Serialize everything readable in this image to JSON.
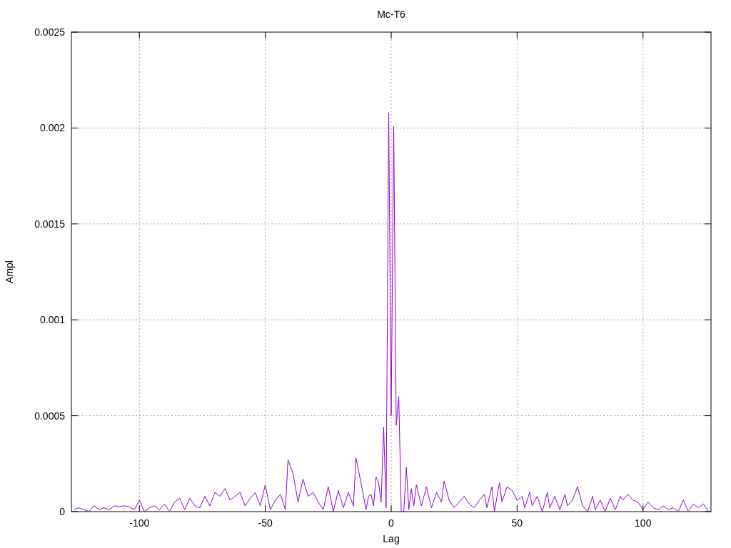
{
  "chart_data": {
    "type": "line",
    "title": "Mc-T6",
    "xlabel": "Lag",
    "ylabel": "Ampl",
    "grid": true,
    "xlim": [
      -127,
      127
    ],
    "ylim": [
      0,
      0.0025
    ],
    "xticks": [
      -100,
      -50,
      0,
      50,
      100
    ],
    "yticks": [
      {
        "value": 0,
        "label": "0"
      },
      {
        "value": 0.0005,
        "label": "0.0005"
      },
      {
        "value": 0.001,
        "label": "0.001"
      },
      {
        "value": 0.0015,
        "label": "0.0015"
      },
      {
        "value": 0.002,
        "label": "0.002"
      },
      {
        "value": 0.0025,
        "label": "0.0025"
      }
    ],
    "x": [
      -126,
      -124,
      -122,
      -120,
      -118,
      -116,
      -114,
      -112,
      -110,
      -108,
      -106,
      -104,
      -102,
      -100,
      -98,
      -96,
      -94,
      -92,
      -90,
      -88,
      -86,
      -84,
      -82,
      -80,
      -78,
      -76,
      -74,
      -72,
      -70,
      -68,
      -66,
      -64,
      -62,
      -60,
      -58,
      -56,
      -54,
      -52,
      -50,
      -48,
      -46,
      -44,
      -42,
      -41,
      -39,
      -37,
      -35,
      -33,
      -31,
      -29,
      -27,
      -25,
      -23,
      -21,
      -19,
      -17,
      -15,
      -14,
      -12,
      -10,
      -9,
      -8,
      -7,
      -6,
      -5,
      -4,
      -3,
      -2,
      -1,
      0,
      1,
      2,
      3,
      4,
      5,
      6,
      7,
      8,
      9,
      10,
      12,
      14,
      16,
      18,
      20,
      21,
      23,
      25,
      27,
      29,
      31,
      33,
      35,
      37,
      38,
      40,
      41,
      43,
      44,
      46,
      48,
      50,
      52,
      53,
      55,
      56,
      58,
      60,
      62,
      63,
      65,
      67,
      69,
      70,
      72,
      74,
      76,
      78,
      80,
      81,
      83,
      85,
      87,
      89,
      91,
      92,
      94,
      96,
      98,
      100,
      102,
      104,
      106,
      108,
      110,
      112,
      114,
      116,
      118,
      120,
      122,
      124,
      126
    ],
    "series": [
      {
        "color": "#9400d3",
        "values": [
          1e-05,
          2e-05,
          1e-05,
          0,
          3e-05,
          1e-05,
          2e-05,
          1e-05,
          3e-05,
          2.5e-05,
          3e-05,
          2.5e-05,
          1e-05,
          6e-05,
          0,
          2e-05,
          3e-05,
          1e-05,
          4e-05,
          0,
          5e-05,
          7e-05,
          1e-05,
          7e-05,
          3e-05,
          2e-05,
          8e-05,
          3e-05,
          0.0001,
          8e-05,
          0.00012,
          6e-05,
          8e-05,
          0.0001,
          3e-05,
          7e-05,
          0.0001,
          3e-05,
          0.00014,
          1e-05,
          6e-05,
          9e-05,
          1e-05,
          0.00027,
          0.0002,
          5e-05,
          0.00017,
          8e-05,
          0.0001,
          5e-05,
          1e-05,
          0.00013,
          0,
          0.00011,
          2e-05,
          0.0001,
          3e-05,
          0.00028,
          0.00015,
          1e-05,
          8e-05,
          9e-05,
          3e-05,
          0.00018,
          0.00015,
          5e-05,
          0.00044,
          2e-05,
          0.00208,
          0.0005,
          0.00201,
          0.00045,
          0.0006,
          0,
          0,
          0.00023,
          1e-05,
          0.00012,
          3e-05,
          0.00014,
          3e-05,
          0.00013,
          2e-05,
          0.0001,
          5e-05,
          0.00016,
          6e-05,
          2e-05,
          5e-05,
          8e-05,
          4e-05,
          2e-05,
          6e-05,
          9e-05,
          2e-05,
          0.00013,
          0,
          0.00015,
          5e-05,
          0.00013,
          0.00011,
          6e-05,
          8e-05,
          2e-05,
          0.0001,
          3e-05,
          8e-05,
          0,
          0.0001,
          2e-05,
          8e-05,
          1e-05,
          9e-05,
          3e-05,
          6e-05,
          0.00013,
          3e-05,
          0,
          8e-05,
          1e-05,
          6e-05,
          0,
          7e-05,
          1e-05,
          8e-05,
          6e-05,
          9e-05,
          6e-05,
          5e-05,
          1e-05,
          5e-05,
          2e-05,
          1e-05,
          3e-05,
          1e-05,
          2e-05,
          0,
          6e-05,
          0,
          4e-05,
          2e-05,
          4e-05,
          0
        ]
      }
    ]
  }
}
